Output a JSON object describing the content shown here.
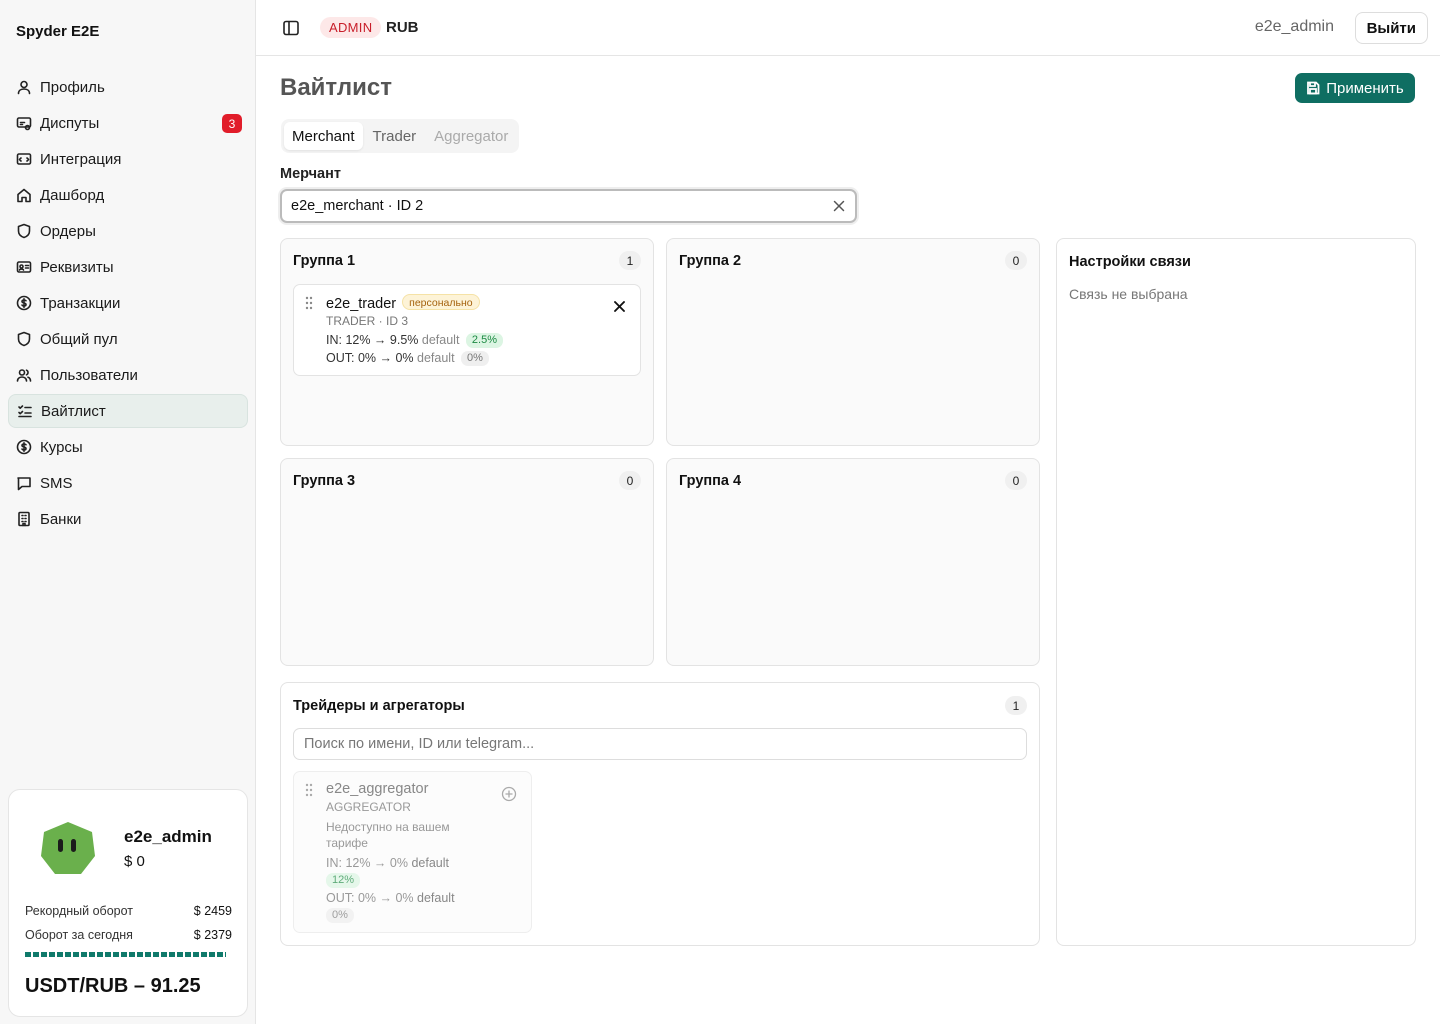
{
  "brand": "Spyder E2E",
  "nav": [
    {
      "label": "Профиль",
      "icon": "user-icon"
    },
    {
      "label": "Диспуты",
      "icon": "dispute-icon",
      "badge": "3"
    },
    {
      "label": "Интеграция",
      "icon": "integration-icon"
    },
    {
      "label": "Дашборд",
      "icon": "home-icon"
    },
    {
      "label": "Ордеры",
      "icon": "shield-icon"
    },
    {
      "label": "Реквизиты",
      "icon": "id-card-icon"
    },
    {
      "label": "Транзакции",
      "icon": "dollar-icon"
    },
    {
      "label": "Общий пул",
      "icon": "shield-icon"
    },
    {
      "label": "Пользователи",
      "icon": "users-icon"
    },
    {
      "label": "Вайтлист",
      "icon": "checklist-icon",
      "active": true
    },
    {
      "label": "Курсы",
      "icon": "dollar-icon"
    },
    {
      "label": "SMS",
      "icon": "message-icon"
    },
    {
      "label": "Банки",
      "icon": "building-icon"
    }
  ],
  "user_card": {
    "name": "e2e_admin",
    "balance": "$ 0",
    "record_label": "Рекордный оборот",
    "record_value": "$ 2459",
    "today_label": "Оборот за сегодня",
    "today_value": "$ 2379",
    "progress": 0.97,
    "rate": "USDT/RUB – 91.25",
    "avatar_color": "#6ab04c"
  },
  "header": {
    "role": "ADMIN",
    "currency": "RUB",
    "user": "e2e_admin",
    "logout": "Выйти"
  },
  "page": {
    "title": "Вайтлист",
    "apply": "Применить",
    "tabs": [
      {
        "label": "Merchant",
        "state": "active"
      },
      {
        "label": "Trader",
        "state": "normal"
      },
      {
        "label": "Aggregator",
        "state": "disabled"
      }
    ],
    "merchant_label": "Мерчант",
    "merchant_value": "e2e_merchant · ID 2"
  },
  "groups": [
    {
      "title": "Группа 1",
      "count": "1"
    },
    {
      "title": "Группа 2",
      "count": "0"
    },
    {
      "title": "Группа 3",
      "count": "0"
    },
    {
      "title": "Группа 4",
      "count": "0"
    }
  ],
  "trader_card": {
    "name": "e2e_trader",
    "tag": "персонально",
    "sub": "TRADER · ID 3",
    "in_line": "IN: 12% → 9.5%",
    "in_default": "default",
    "in_pill": "2.5%",
    "out_line": "OUT: 0% → 0%",
    "out_default": "default",
    "out_pill": "0%"
  },
  "settings": {
    "title": "Настройки связи",
    "empty": "Связь не выбрана"
  },
  "pool": {
    "title": "Трейдеры и агрегаторы",
    "count": "1",
    "search_placeholder": "Поиск по имени, ID или telegram...",
    "card": {
      "name": "e2e_aggregator",
      "sub": "AGGREGATOR",
      "note_1": "Недоступно на вашем",
      "note_2": "тарифе",
      "in_line": "IN: 12% → 0%",
      "in_default": "default",
      "in_pill": "12%",
      "out_line": "OUT: 0% → 0%",
      "out_default": "default",
      "out_pill": "0%"
    }
  },
  "colors": {
    "accent": "#0f6e62",
    "danger": "#e11d2a"
  }
}
